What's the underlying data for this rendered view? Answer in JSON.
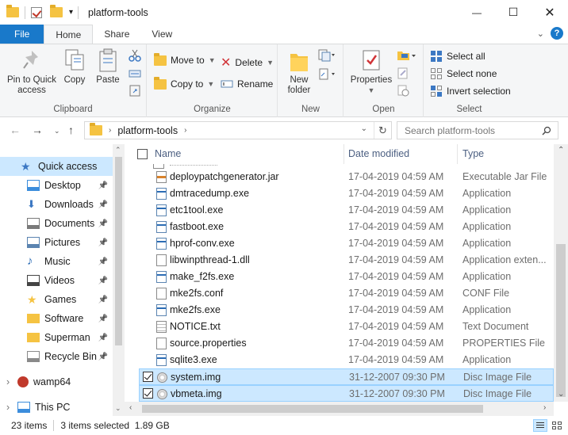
{
  "window": {
    "title": "platform-tools",
    "minimize": "—",
    "maximize": "☐",
    "close": "✕"
  },
  "tabs": [
    "File",
    "Home",
    "Share",
    "View"
  ],
  "ribbon": {
    "clipboard": {
      "label": "Clipboard",
      "pin_line1": "Pin to Quick",
      "pin_line2": "access",
      "copy": "Copy",
      "paste": "Paste"
    },
    "organize": {
      "label": "Organize",
      "move_to": "Move to",
      "copy_to": "Copy to",
      "delete": "Delete",
      "rename": "Rename"
    },
    "new": {
      "label": "New",
      "new_folder_line1": "New",
      "new_folder_line2": "folder"
    },
    "open": {
      "label": "Open",
      "properties": "Properties"
    },
    "select": {
      "label": "Select",
      "select_all": "Select all",
      "select_none": "Select none",
      "invert": "Invert selection"
    }
  },
  "address": {
    "path": "platform-tools",
    "search_placeholder": "Search platform-tools"
  },
  "nav_pane": [
    {
      "label": "Quick access",
      "icon": "star-icon",
      "selected": true
    },
    {
      "label": "Desktop",
      "icon": "desktop-icon",
      "pinned": true
    },
    {
      "label": "Downloads",
      "icon": "download-icon",
      "pinned": true
    },
    {
      "label": "Documents",
      "icon": "documents-icon",
      "pinned": true
    },
    {
      "label": "Pictures",
      "icon": "pictures-icon",
      "pinned": true
    },
    {
      "label": "Music",
      "icon": "music-icon",
      "pinned": true
    },
    {
      "label": "Videos",
      "icon": "videos-icon",
      "pinned": true
    },
    {
      "label": "Games",
      "icon": "star-icon",
      "pinned": true
    },
    {
      "label": "Software",
      "icon": "folder-icon",
      "pinned": true
    },
    {
      "label": "Superman",
      "icon": "folder-icon",
      "pinned": true
    },
    {
      "label": "Recycle Bin",
      "icon": "recycle-bin-icon",
      "pinned": true
    },
    {
      "label": "wamp64",
      "icon": "wamp-icon"
    },
    {
      "label": "This PC",
      "icon": "computer-icon"
    }
  ],
  "columns": {
    "name": "Name",
    "date": "Date modified",
    "type": "Type"
  },
  "files": [
    {
      "name": "deploypatchgenerator.jar",
      "date": "17-04-2019 04:59 AM",
      "type": "Executable Jar File",
      "kind": "jar",
      "selected": false
    },
    {
      "name": "dmtracedump.exe",
      "date": "17-04-2019 04:59 AM",
      "type": "Application",
      "kind": "app",
      "selected": false
    },
    {
      "name": "etc1tool.exe",
      "date": "17-04-2019 04:59 AM",
      "type": "Application",
      "kind": "app",
      "selected": false
    },
    {
      "name": "fastboot.exe",
      "date": "17-04-2019 04:59 AM",
      "type": "Application",
      "kind": "app",
      "selected": false
    },
    {
      "name": "hprof-conv.exe",
      "date": "17-04-2019 04:59 AM",
      "type": "Application",
      "kind": "app",
      "selected": false
    },
    {
      "name": "libwinpthread-1.dll",
      "date": "17-04-2019 04:59 AM",
      "type": "Application exten...",
      "kind": "dll",
      "selected": false
    },
    {
      "name": "make_f2fs.exe",
      "date": "17-04-2019 04:59 AM",
      "type": "Application",
      "kind": "app",
      "selected": false
    },
    {
      "name": "mke2fs.conf",
      "date": "17-04-2019 04:59 AM",
      "type": "CONF File",
      "kind": "file",
      "selected": false
    },
    {
      "name": "mke2fs.exe",
      "date": "17-04-2019 04:59 AM",
      "type": "Application",
      "kind": "app",
      "selected": false
    },
    {
      "name": "NOTICE.txt",
      "date": "17-04-2019 04:59 AM",
      "type": "Text Document",
      "kind": "txt",
      "selected": false
    },
    {
      "name": "source.properties",
      "date": "17-04-2019 04:59 AM",
      "type": "PROPERTIES File",
      "kind": "file",
      "selected": false
    },
    {
      "name": "sqlite3.exe",
      "date": "17-04-2019 04:59 AM",
      "type": "Application",
      "kind": "app",
      "selected": false
    },
    {
      "name": "system.img",
      "date": "31-12-2007 09:30 PM",
      "type": "Disc Image File",
      "kind": "img",
      "selected": true
    },
    {
      "name": "vbmeta.img",
      "date": "31-12-2007 09:30 PM",
      "type": "Disc Image File",
      "kind": "img",
      "selected": true
    }
  ],
  "status": {
    "items": "23 items",
    "selected": "3 items selected  1.89 GB"
  },
  "colors": {
    "accent": "#1979ca",
    "selection": "#cce8ff"
  }
}
